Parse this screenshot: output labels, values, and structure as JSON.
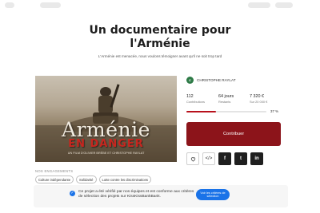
{
  "header": {
    "title_line1": "Un documentaire pour",
    "title_line2": "l'Arménie",
    "subtitle": "L'Arménie est menacée, nous voulons témoigner avant qu'il ne soit trop tard"
  },
  "hero": {
    "title": "Arménie",
    "subtitle": "EN DANGER",
    "credit": "UN FILM D'OLIVIER BRÉBE ET CHRISTOPHE RAYLAT"
  },
  "tags": {
    "label": "NOS ENGAGEMENTS",
    "items": [
      "Culture indépendante",
      "Solidarité",
      "Lutte contre les discriminations"
    ]
  },
  "owner": {
    "initials": "C",
    "name": "CHRISTOPHE RAYLAT",
    "color": "#2d7a46"
  },
  "stats": {
    "contributions_value": "112",
    "contributions_label": "Contributions",
    "days_value": "64 jours",
    "days_label": "Restants",
    "amount_value": "7 320 €",
    "amount_label": "Sur 20 000 €",
    "percent_label": "37 %",
    "progress": 0.37
  },
  "cta": {
    "label": "Contribuer",
    "color": "#8c141a"
  },
  "share": {
    "like_icon": "heart-icon",
    "embed_glyph": "</>",
    "facebook_glyph": "f",
    "twitter_glyph": "t",
    "linkedin_glyph": "in"
  },
  "notice": {
    "message": "Ce projet a été vérifié par nos équipes et est conforme aux critères de sélection des projets sur KissKissBankBank.",
    "button_label": "Voir les critères de sélection",
    "accent": "#1a73e8"
  }
}
